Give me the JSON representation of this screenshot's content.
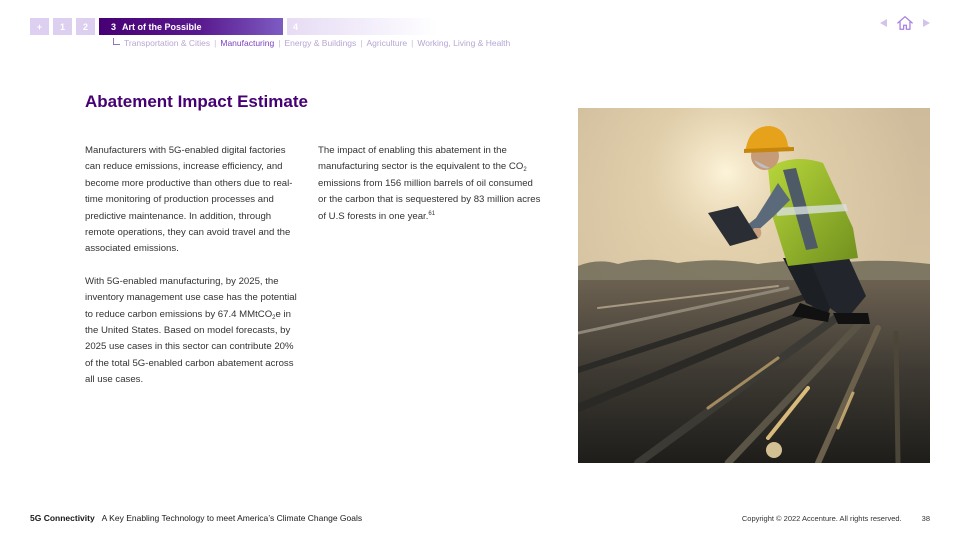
{
  "nav": {
    "boxes": [
      {
        "label": "+",
        "num": ""
      },
      {
        "label": "1"
      },
      {
        "label": "2"
      },
      {
        "num": "3",
        "label": "Art of the Possible"
      },
      {
        "label": "4"
      }
    ],
    "subnav": [
      "Transportation & Cities",
      "Manufacturing",
      "Energy & Buildings",
      "Agriculture",
      "Working, Living & Health"
    ],
    "subnav_current": "Manufacturing",
    "icons": [
      "prev-arrow-icon",
      "home-icon",
      "next-arrow-icon"
    ],
    "accent": "#460073"
  },
  "main": {
    "title": "Abatement Impact Estimate",
    "col1": {
      "p1": "Manufacturers with 5G-enabled digital factories can reduce emissions, increase efficiency, and become more productive than others due to real-time monitoring of production processes and predictive maintenance. In addition, through remote operations, they can avoid travel and the associated emissions.",
      "p2_a": "With 5G-enabled manufacturing, by 2025, the inventory management use case has the potential to reduce carbon emissions by 67.4 MMtCO",
      "p2_sub": "2",
      "p2_b": "e in the United States. Based on model forecasts, by 2025 use cases in this sector can contribute 20% of the total 5G-enabled carbon abatement across all use cases."
    },
    "col2": {
      "a": "The impact of enabling this abatement in the manufacturing sector is the equivalent to the CO",
      "sub": "2",
      "b": " emissions from 156 million barrels of oil consumed or the carbon that is sequestered by 83 million acres of U.S forests in one year.",
      "sup": "61"
    },
    "photo": "worker in hard hat and safety vest crouching on factory roof with tablet at sunset"
  },
  "footer": {
    "brand": "5G Connectivity",
    "subtitle": "A Key Enabling Technology to meet America’s Climate Change Goals",
    "copyright": "Copyright © 2022 Accenture. All rights reserved.",
    "page": "38"
  }
}
